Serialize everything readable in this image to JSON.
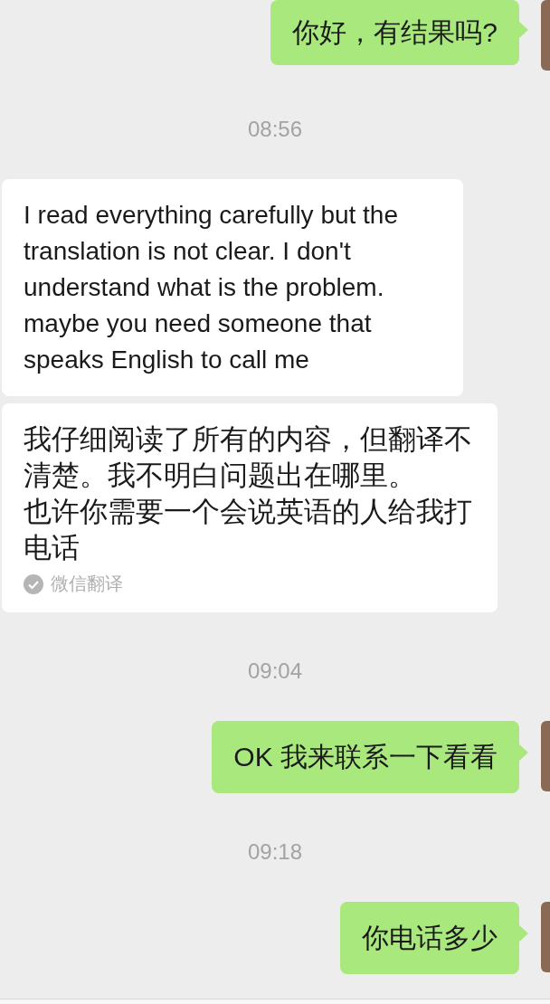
{
  "messages": [
    {
      "kind": "sent",
      "text": "你好，有结果吗?"
    },
    {
      "kind": "time",
      "text": "08:56"
    },
    {
      "kind": "received",
      "text": "I read everything carefully but the translation is not clear. I don't understand what is the problem. maybe you need someone that speaks English to call me"
    },
    {
      "kind": "translation",
      "lines": [
        "我仔细阅读了所有的内容，但翻译不清楚。我不明白问题出在哪里。",
        "也许你需要一个会说英语的人给我打电话"
      ],
      "source": "微信翻译"
    },
    {
      "kind": "time",
      "text": "09:04"
    },
    {
      "kind": "sent",
      "text": "OK 我来联系一下看看"
    },
    {
      "kind": "time",
      "text": "09:18"
    },
    {
      "kind": "sent",
      "text": "你电话多少"
    }
  ]
}
